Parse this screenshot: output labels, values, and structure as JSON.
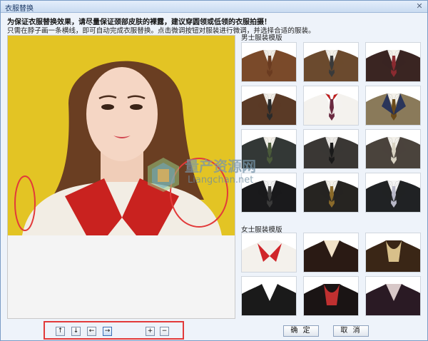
{
  "window": {
    "title": "衣服替换",
    "close_glyph": "✕"
  },
  "hints": {
    "line1": "为保证衣服替换效果，请尽量保证颈部皮肤的裸露，建议穿圆领或低领的衣服拍摄！",
    "line2": "只需在脖子画一条横线，即可自动完成衣服替换。点击微调按钮对服装进行微调，并选择合适的服装。"
  },
  "sections": {
    "male": "男士服装模版",
    "female": "女士服装模版"
  },
  "controls": {
    "up": "↑",
    "down": "↓",
    "left": "←",
    "right": "→",
    "plus": "+",
    "minus": "−"
  },
  "buttons": {
    "ok": "确 定",
    "cancel": "取 消"
  },
  "watermark": {
    "cn": "量产资源网",
    "en": "Liangchan.net"
  },
  "colors": {
    "accent": "#3a6fb5",
    "highlight_red": "#e23a3a",
    "background_yellow": "#e3c424"
  },
  "male_templates": [
    {
      "suit": "#7a4a2a",
      "shirt": "#f2efe8",
      "tie": "#6a3b20"
    },
    {
      "suit": "#6b4a2e",
      "shirt": "#f4f1ea",
      "tie": "#3a3a3a"
    },
    {
      "suit": "#3a2522",
      "shirt": "#f4f1ea",
      "tie": "#8a2a30"
    },
    {
      "suit": "#5a3a26",
      "shirt": "#f2efe8",
      "tie": "#2a2a2a"
    },
    {
      "suit": "#f4f2ee",
      "shirt": "#ffffff",
      "tie": "#6a2a40",
      "collar": "#c41c1c"
    },
    {
      "suit": "#1f2e5a",
      "shirt": "#f4f1ea",
      "tie": "#6a4a1a",
      "outer": "#8a7a5a"
    },
    {
      "suit": "#333836",
      "shirt": "#f4f1ea",
      "tie": "#4a5a3a"
    },
    {
      "suit": "#3a3734",
      "shirt": "#eceae6",
      "tie": "#1a1a1a"
    },
    {
      "suit": "#4a433c",
      "shirt": "#f4f1ea",
      "tie": "#d8d2c2"
    },
    {
      "suit": "#1a1a1c",
      "shirt": "#f4f4f4",
      "tie": "#3a3a3a"
    },
    {
      "suit": "#262421",
      "shirt": "#f4f1ea",
      "tie": "#8a6a2a"
    },
    {
      "suit": "#202224",
      "shirt": "#f4f4f4",
      "tie": "#b8b8c8"
    }
  ],
  "female_templates": [
    {
      "suit": "#f4f1ec",
      "collar": "#d0262a",
      "type": "collar"
    },
    {
      "suit": "#2a1a14",
      "collar": "#f2e2c8",
      "type": "v"
    },
    {
      "suit": "#3a2616",
      "collar": "#d8c08a",
      "type": "scarf"
    },
    {
      "suit": "#1a1a1a",
      "collar": "#ffffff",
      "type": "v"
    },
    {
      "suit": "#1a1414",
      "collar": "#c03030",
      "type": "scarf"
    },
    {
      "suit": "#2a1a24",
      "collar": "#d8c8c8",
      "type": "v"
    }
  ]
}
